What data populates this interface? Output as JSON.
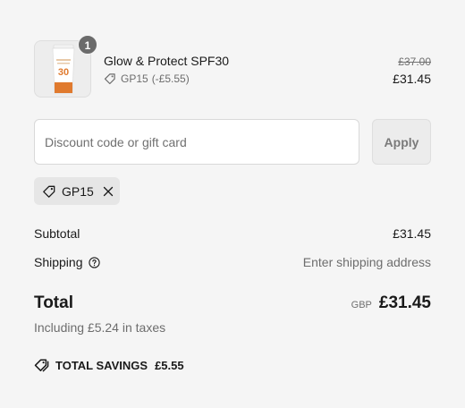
{
  "product": {
    "name": "Glow & Protect SPF30",
    "quantity": "1",
    "discount_code": "GP15",
    "discount_amount": "(-£5.55)",
    "original_price": "£37.00",
    "price": "£31.45",
    "thumbnail_label": "30"
  },
  "discount": {
    "placeholder": "Discount code or gift card",
    "value": "",
    "apply_label": "Apply",
    "applied_code": "GP15"
  },
  "totals": {
    "subtotal_label": "Subtotal",
    "subtotal_value": "£31.45",
    "shipping_label": "Shipping",
    "shipping_value": "Enter shipping address",
    "total_label": "Total",
    "currency": "GBP",
    "total_value": "£31.45",
    "tax_note": "Including £5.24 in taxes",
    "savings_label": "TOTAL SAVINGS",
    "savings_value": "£5.55"
  },
  "icons": {
    "tag": "tag-icon",
    "close": "close-icon",
    "help": "help-circle-icon",
    "savings": "savings-tag-icon"
  },
  "colors": {
    "background": "#f5f5f5",
    "text": "#1a1a1a",
    "muted": "#6d6d6d",
    "badge": "#6b6b6b",
    "tube_accent": "#e07a2e"
  }
}
